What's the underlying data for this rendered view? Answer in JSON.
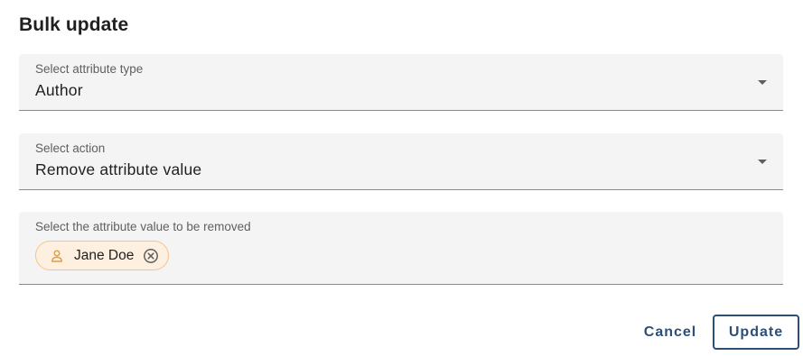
{
  "dialog": {
    "title": "Bulk update"
  },
  "attribute_type": {
    "label": "Select attribute type",
    "value": "Author",
    "icon": "chevron-down-icon"
  },
  "action": {
    "label": "Select action",
    "value": "Remove attribute value",
    "icon": "chevron-down-icon"
  },
  "attribute_value": {
    "label": "Select the attribute value to be removed",
    "chips": [
      {
        "label": "Jane Doe",
        "icon": "person-icon",
        "remove_icon": "close-circle-icon"
      }
    ]
  },
  "buttons": {
    "cancel": "Cancel",
    "update": "Update"
  },
  "colors": {
    "primary": "#2b4f78",
    "chip_background": "#fdf0e1",
    "chip_border": "#f2c48d",
    "chip_icon": "#e39a3c",
    "field_background": "#f4f4f4"
  }
}
